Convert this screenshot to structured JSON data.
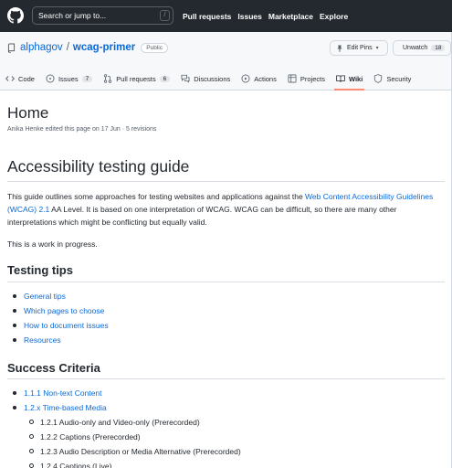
{
  "header": {
    "search_placeholder": "Search or jump to...",
    "search_shortcut": "/",
    "nav": [
      "Pull requests",
      "Issues",
      "Marketplace",
      "Explore"
    ]
  },
  "repo": {
    "owner": "alphagov",
    "separator": "/",
    "name": "wcag-primer",
    "visibility": "Public",
    "edit_pins_label": "Edit Pins",
    "unwatch_label": "Unwatch",
    "watch_count": "18"
  },
  "tabs": [
    {
      "label": "Code",
      "icon": "code-icon"
    },
    {
      "label": "Issues",
      "count": "7",
      "icon": "issue-icon"
    },
    {
      "label": "Pull requests",
      "count": "6",
      "icon": "pull-request-icon"
    },
    {
      "label": "Discussions",
      "icon": "discussions-icon"
    },
    {
      "label": "Actions",
      "icon": "actions-icon"
    },
    {
      "label": "Projects",
      "icon": "projects-icon"
    },
    {
      "label": "Wiki",
      "icon": "wiki-icon",
      "selected": true
    },
    {
      "label": "Security",
      "icon": "shield-icon"
    }
  ],
  "page": {
    "title": "Home",
    "meta": "Anika Henke edited this page on 17 Jun · 5 revisions"
  },
  "article": {
    "heading": "Accessibility testing guide",
    "intro_before": "This guide outlines some approaches for testing websites and applications against the ",
    "intro_link": "Web Content Accessibility Guidelines (WCAG) 2.1",
    "intro_after": " AA Level. It is based on one interpretation of WCAG. WCAG can be difficult, so there are many other interpretations which might be conflicting but equally valid.",
    "wip": "This is a work in progress.",
    "testing_tips_heading": "Testing tips",
    "testing_tips": [
      "General tips",
      "Which pages to choose",
      "How to document issues",
      "Resources"
    ],
    "success_criteria_heading": "Success Criteria",
    "criteria": [
      {
        "label": "1.1.1 Non-text Content",
        "children": []
      },
      {
        "label": "1.2.x Time-based Media",
        "children": [
          "1.2.1 Audio-only and Video-only (Prerecorded)",
          "1.2.2 Captions (Prerecorded)",
          "1.2.3 Audio Description or Media Alternative (Prerecorded)",
          "1.2.4 Captions (Live)"
        ]
      }
    ]
  },
  "colors": {
    "header_bg": "#24292f",
    "link": "#0969da",
    "tab_underline": "#fd8c73"
  }
}
